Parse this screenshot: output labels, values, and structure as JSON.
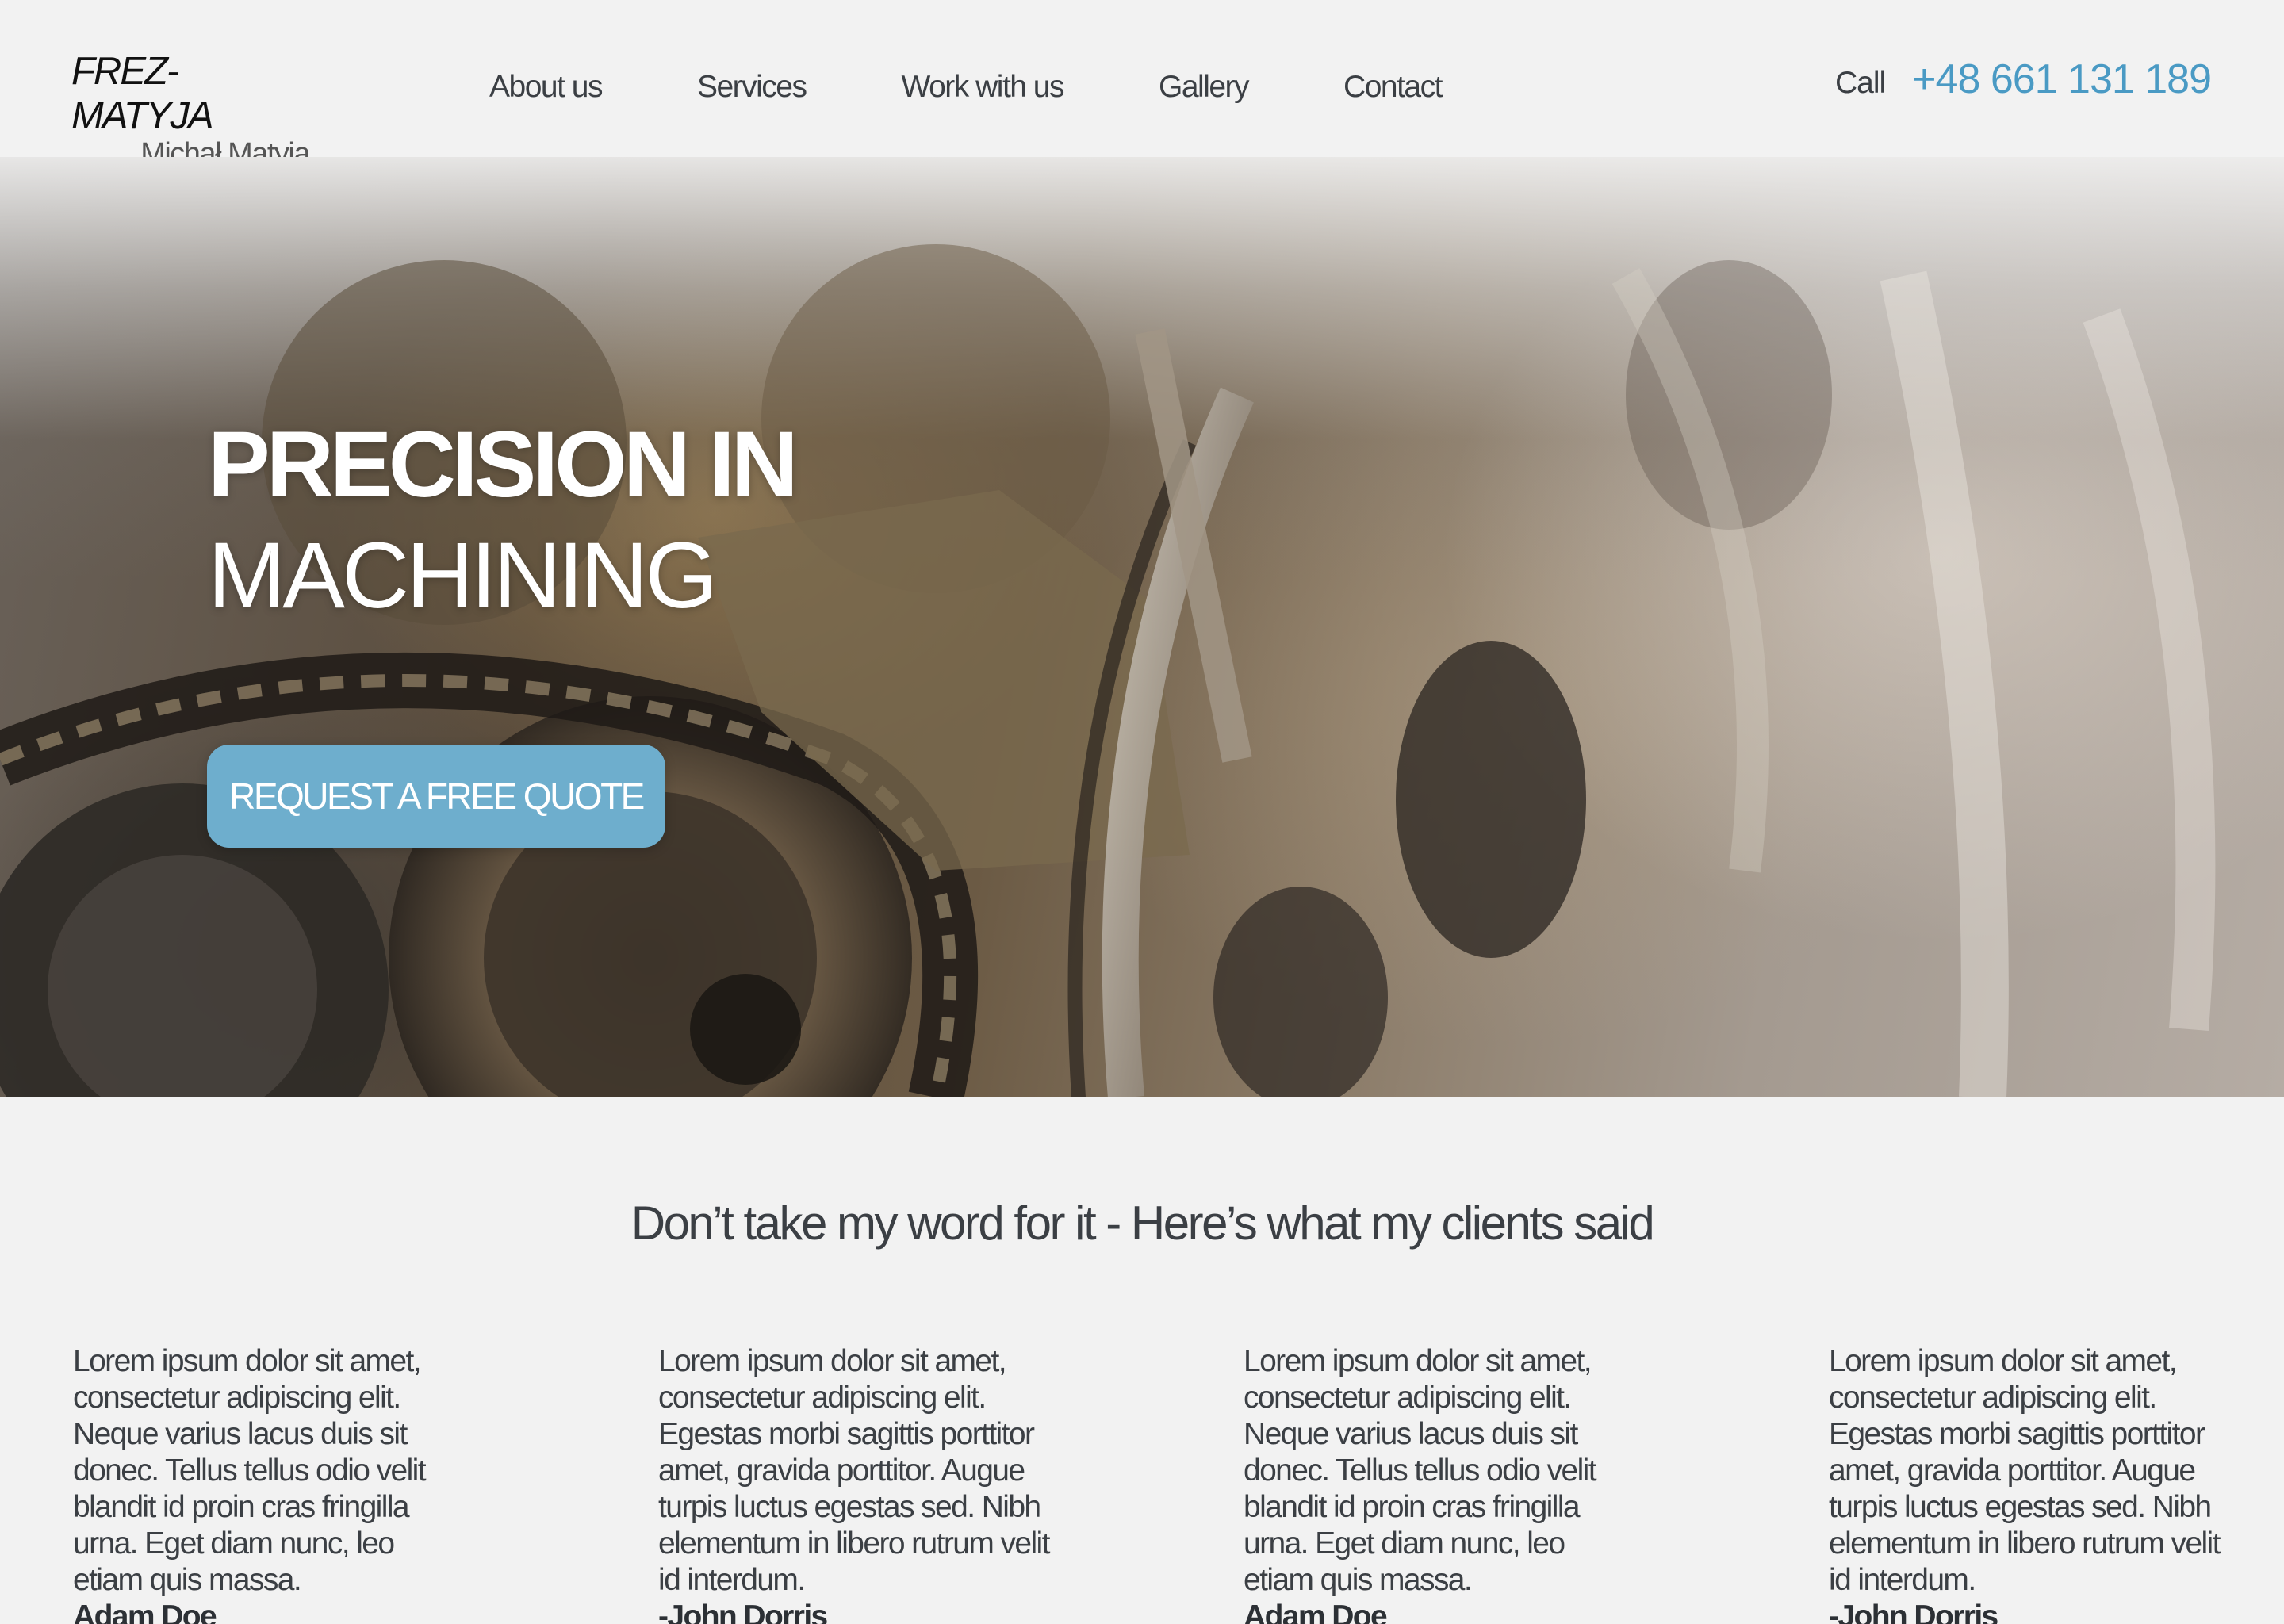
{
  "logo": {
    "title": "FREZ-MATYJA",
    "subtitle": "Michał Matyja"
  },
  "nav": {
    "items": [
      {
        "label": "About us"
      },
      {
        "label": "Services"
      },
      {
        "label": "Work with us"
      },
      {
        "label": "Gallery"
      },
      {
        "label": "Contact"
      }
    ]
  },
  "contact": {
    "call_label": "Call",
    "phone": "+48 661 131 189"
  },
  "hero": {
    "title_line1": "PRECISION IN",
    "title_line2": "MACHINING",
    "cta_label": "REQUEST A FREE QUOTE",
    "image_subject": "engine-machinery-photo"
  },
  "testimonials": {
    "heading": "Don’t take my word for it - Here’s what my clients said",
    "items": [
      {
        "text": "Lorem ipsum dolor sit amet, consectetur adipiscing elit. Neque varius lacus duis sit donec. Tellus tellus odio velit blandit id proin cras fringilla urna. Eget diam nunc, leo etiam quis massa.",
        "author": "Adam Doe"
      },
      {
        "text": "Lorem ipsum dolor sit amet, consectetur adipiscing elit. Egestas morbi sagittis porttitor amet, gravida porttitor. Augue turpis luctus egestas sed. Nibh elementum in libero rutrum velit id interdum.",
        "author": "-John Dorris"
      },
      {
        "text": "Lorem ipsum dolor sit amet, consectetur adipiscing elit. Neque varius lacus duis sit donec. Tellus tellus odio velit blandit id proin cras fringilla urna. Eget diam nunc, leo etiam quis massa.",
        "author": "Adam Doe"
      },
      {
        "text": "Lorem ipsum dolor sit amet, consectetur adipiscing elit. Egestas morbi sagittis porttitor amet, gravida porttitor. Augue turpis luctus egestas sed. Nibh elementum in libero rutrum velit id interdum.",
        "author": "-John Dorris"
      }
    ]
  },
  "colors": {
    "background": "#f2f2f2",
    "accent": "#4a9ac4",
    "button": "#6eaecd",
    "text": "#3b3f44"
  }
}
